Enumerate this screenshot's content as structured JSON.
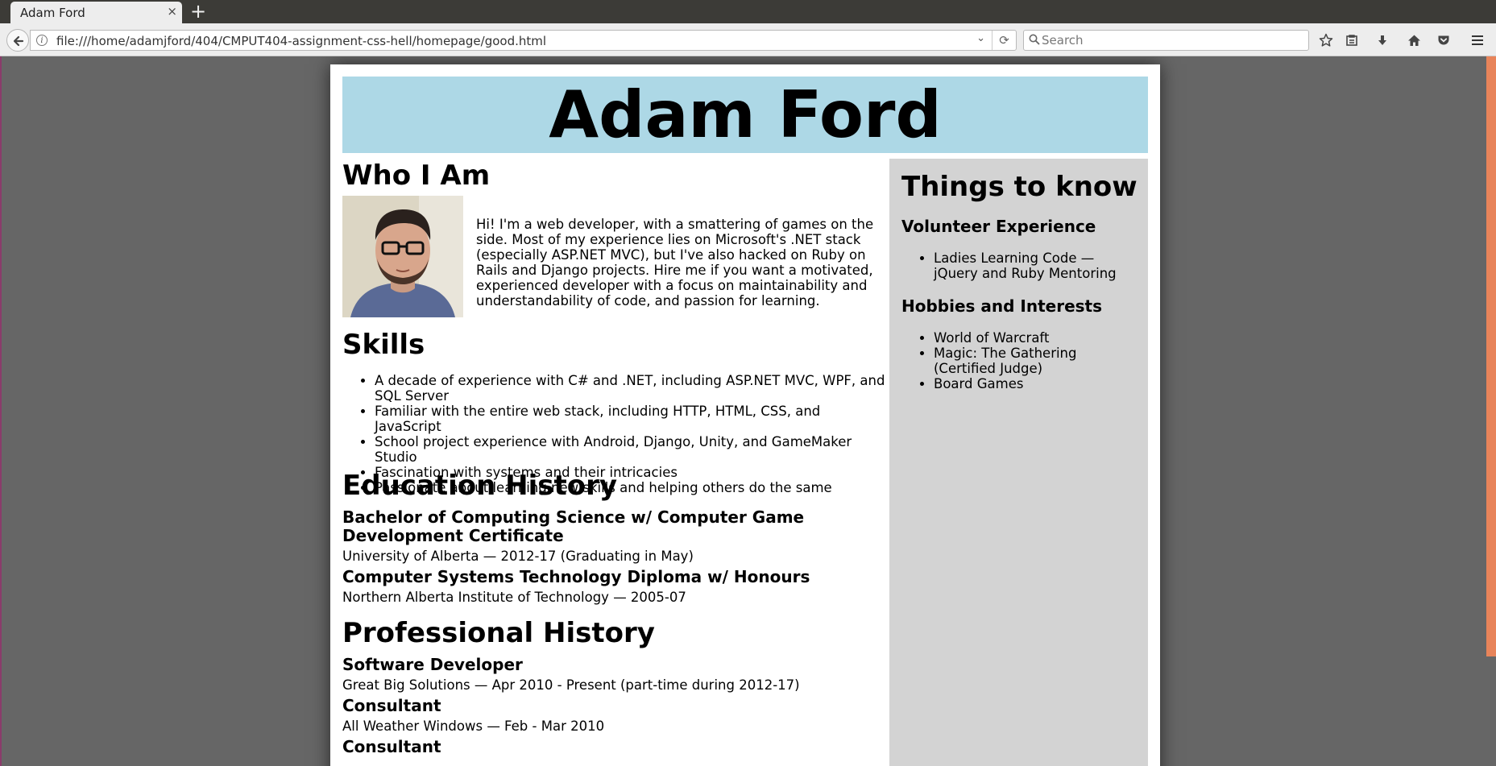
{
  "browser": {
    "tab_title": "Adam Ford",
    "tab_close": "×",
    "new_tab": "+",
    "url": "file:///home/adamjford/404/CMPUT404-assignment-css-hell/homepage/good.html",
    "search_placeholder": "Search"
  },
  "icons": {
    "back": "back-arrow-icon",
    "info": "info-icon",
    "reload": "reload-icon",
    "search": "search-icon",
    "bookmark": "star-icon",
    "reading_list": "clipboard-icon",
    "downloads": "download-icon",
    "home": "home-icon",
    "pocket": "pocket-icon",
    "menu": "hamburger-menu-icon"
  },
  "colors": {
    "banner": "#add8e6",
    "sidebar": "#d3d3d3",
    "background": "#666666",
    "accent": "#e8845a"
  },
  "page": {
    "name": "Adam Ford",
    "who_heading": "Who I Am",
    "bio": "Hi! I'm a web developer, with a smattering of games on the side. Most of my experience lies on Microsoft's .NET stack (especially ASP.NET MVC), but I've also hacked on Ruby on Rails and Django projects. Hire me if you want a motivated, experienced developer with a focus on maintainability and understandability of code, and passion for learning.",
    "skills_heading": "Skills",
    "skills": [
      "A decade of experience with C# and .NET, including ASP.NET MVC, WPF, and SQL Server",
      "Familiar with the entire web stack, including HTTP, HTML, CSS, and JavaScript",
      "School project experience with Android, Django, Unity, and GameMaker Studio",
      "Fascination with systems and their intricacies",
      "Passionate about learning new skills and helping others do the same"
    ],
    "education_heading": "Education History",
    "education": [
      {
        "degree": "Bachelor of Computing Science w/ Computer Game Development Certificate",
        "detail": "University of Alberta — 2012-17 (Graduating in May)"
      },
      {
        "degree": "Computer Systems Technology Diploma w/ Honours",
        "detail": "Northern Alberta Institute of Technology — 2005-07"
      }
    ],
    "professional_heading": "Professional History",
    "jobs": [
      {
        "title": "Software Developer",
        "detail": "Great Big Solutions — Apr 2010 - Present (part-time during 2012-17)"
      },
      {
        "title": "Consultant",
        "detail": "All Weather Windows — Feb - Mar 2010"
      },
      {
        "title": "Consultant"
      }
    ],
    "sidebar": {
      "heading": "Things to know",
      "volunteer_heading": "Volunteer Experience",
      "volunteer": [
        "Ladies Learning Code — jQuery and Ruby Mentoring"
      ],
      "hobbies_heading": "Hobbies and Interests",
      "hobbies": [
        "World of Warcraft",
        "Magic: The Gathering (Certified Judge)",
        "Board Games"
      ]
    }
  }
}
